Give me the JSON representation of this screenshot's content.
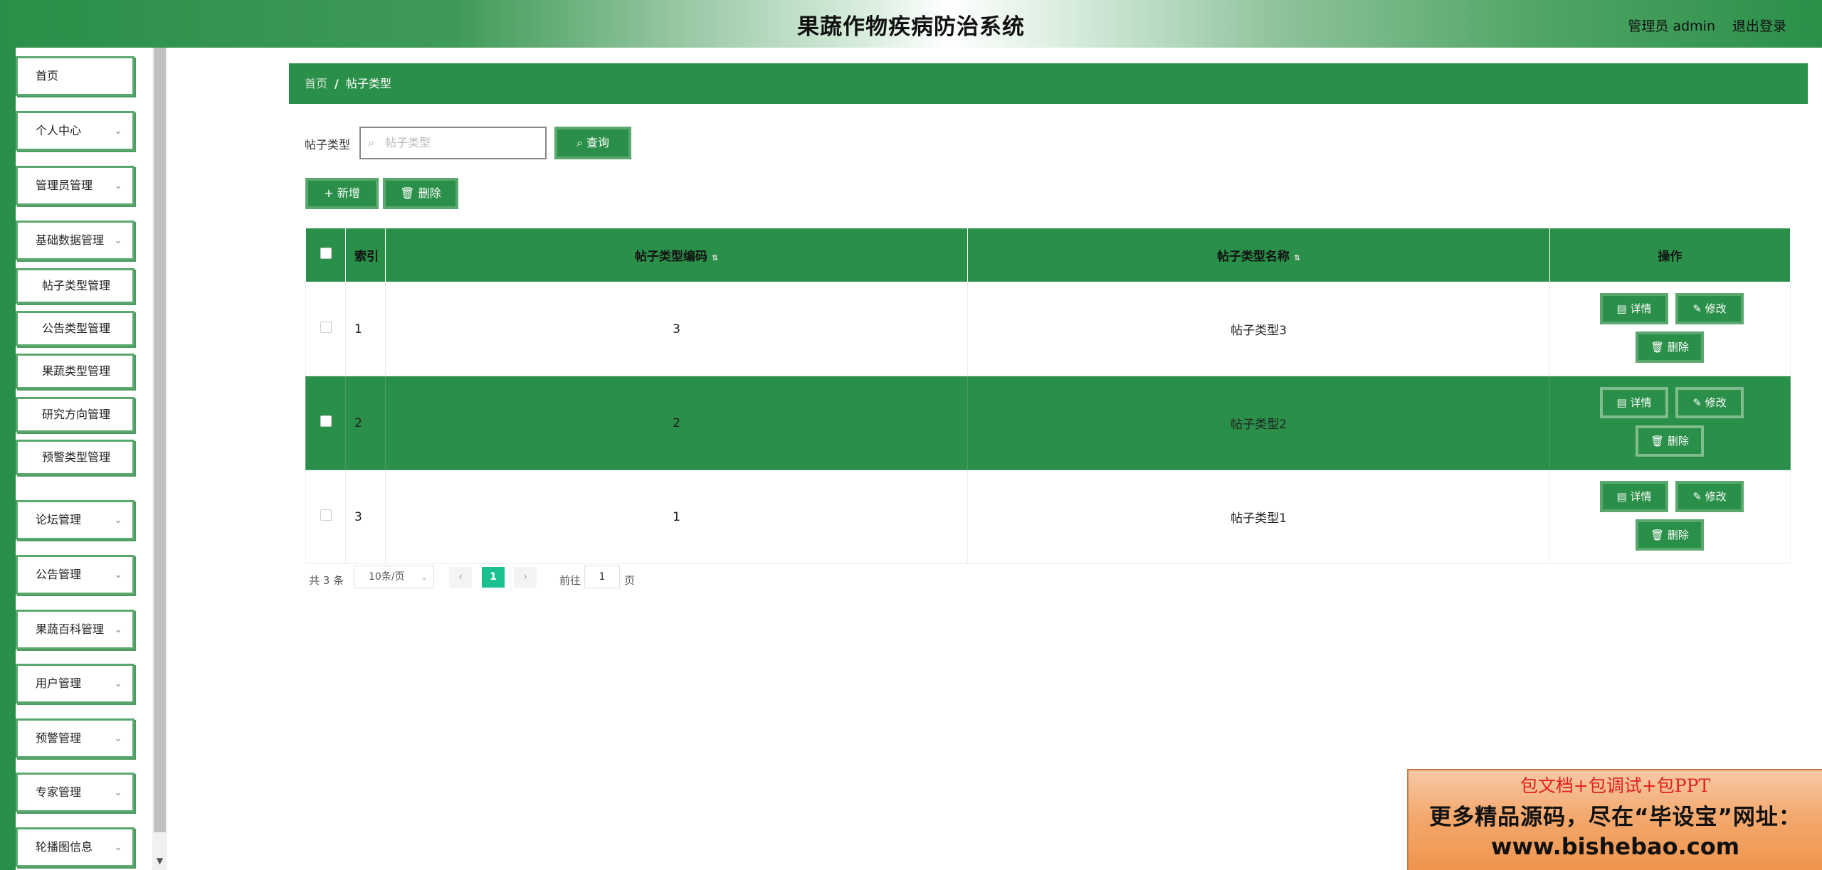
{
  "header": {
    "title": "果蔬作物疾病防治系统",
    "user": "管理员 admin",
    "logout": "退出登录"
  },
  "sidebar": {
    "items": [
      {
        "label": "首页",
        "expandable": false
      },
      {
        "label": "个人中心",
        "expandable": true
      },
      {
        "label": "管理员管理",
        "expandable": true
      },
      {
        "label": "基础数据管理",
        "expandable": true
      },
      {
        "label": "帖子类型管理",
        "sub": true
      },
      {
        "label": "公告类型管理",
        "sub": true
      },
      {
        "label": "果蔬类型管理",
        "sub": true
      },
      {
        "label": "研究方向管理",
        "sub": true
      },
      {
        "label": "预警类型管理",
        "sub": true
      },
      {
        "label": "论坛管理",
        "expandable": true
      },
      {
        "label": "公告管理",
        "expandable": true
      },
      {
        "label": "果蔬百科管理",
        "expandable": true
      },
      {
        "label": "用户管理",
        "expandable": true
      },
      {
        "label": "预警管理",
        "expandable": true
      },
      {
        "label": "专家管理",
        "expandable": true
      },
      {
        "label": "轮播图信息",
        "expandable": true
      }
    ],
    "chevron": "chevron-down-icon"
  },
  "breadcrumb": {
    "home": "首页",
    "separator": "/",
    "current": "帖子类型"
  },
  "search": {
    "label": "帖子类型",
    "placeholder": "帖子类型",
    "query_button": "查询"
  },
  "toolbar": {
    "add_button": "新增",
    "delete_button": "删除"
  },
  "table": {
    "headers": {
      "index": "索引",
      "code": "帖子类型编码",
      "name": "帖子类型名称",
      "ops": "操作"
    },
    "rows": [
      {
        "index": "1",
        "code": "3",
        "name": "帖子类型3",
        "highlighted": false
      },
      {
        "index": "2",
        "code": "2",
        "name": "帖子类型2",
        "highlighted": true
      },
      {
        "index": "3",
        "code": "1",
        "name": "帖子类型1",
        "highlighted": false
      }
    ],
    "row_actions": {
      "detail": "详情",
      "edit": "修改",
      "delete": "删除"
    }
  },
  "pagination": {
    "total_text": "共 3 条",
    "page_size": "10条/页",
    "current_page": "1",
    "goto_label": "前往",
    "goto_value": "1",
    "page_unit": "页"
  },
  "ad": {
    "line1": "包文档+包调试+包PPT",
    "line2": "更多精品源码，尽在“毕设宝”网址：",
    "line3": "www.bishebao.com"
  },
  "colors": {
    "primary": "#2a8f48",
    "accent_border": "#5aa86e",
    "pager_active": "#1cbf8f"
  }
}
